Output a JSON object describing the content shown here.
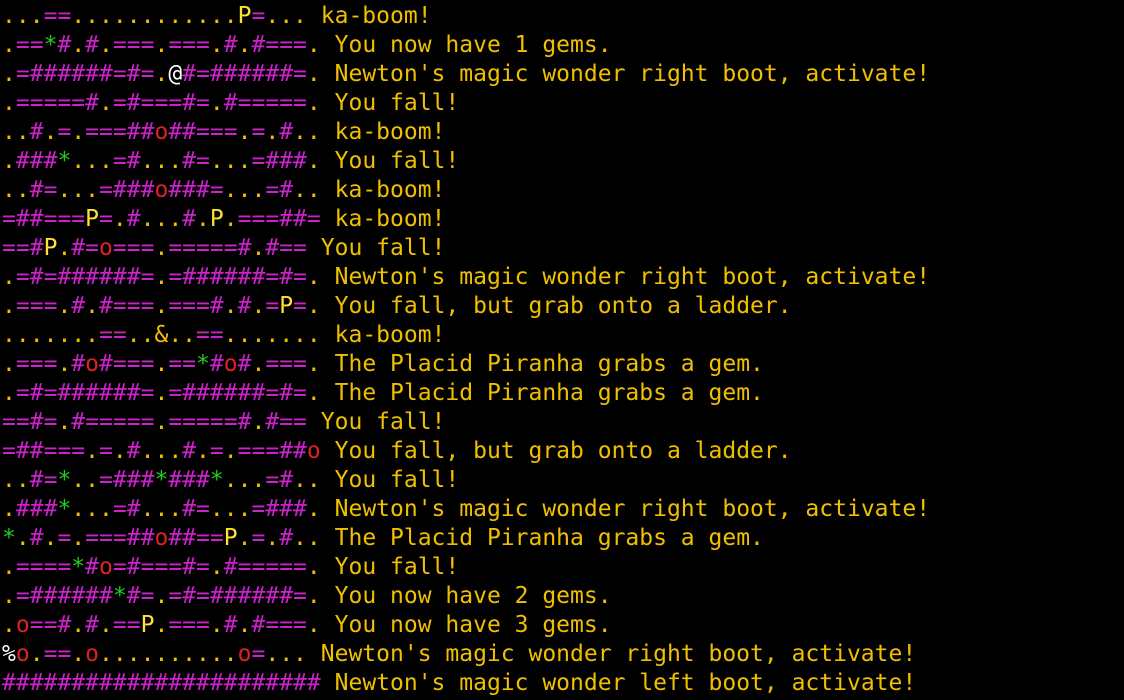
{
  "palette": {
    "background": "#000000",
    "text": "#f0c000",
    "wall": "#cc22cc",
    "gem": "#22cc22",
    "hole": "#dd2222",
    "player": "#ffe033",
    "hero": "#ffffff"
  },
  "terminal": {
    "lines": [
      {
        "map": "...==............P=...",
        "message": "ka-boom!"
      },
      {
        "map": ".==*#.#.===.===.#.#===.",
        "message": "You now have 1 gems."
      },
      {
        "map": ".=######=#=.@#=######=.",
        "message": "Newton's magic wonder right boot, activate!"
      },
      {
        "map": ".=====#.=#===#=.#=====.",
        "message": "You fall!"
      },
      {
        "map": "..#.=.===##o##===.=.#..",
        "message": "ka-boom!"
      },
      {
        "map": ".###*...=#...#=...=###.",
        "message": "You fall!"
      },
      {
        "map": "..#=...=###o###=...=#..",
        "message": "ka-boom!"
      },
      {
        "map": "=##===P=.#...#.P.===##=",
        "message": "ka-boom!"
      },
      {
        "map": "==#P.#=o===.=====#.#==",
        "message": "You fall!"
      },
      {
        "map": ".=#=######=.=######=#=.",
        "message": "Newton's magic wonder right boot, activate!"
      },
      {
        "map": ".===.#.#===.===#.#.=P=.",
        "message": "You fall, but grab onto a ladder."
      },
      {
        "map": ".......==..&..==.......",
        "message": "ka-boom!"
      },
      {
        "map": ".===.#o#===.==*#o#.===.",
        "message": "The Placid Piranha grabs a gem."
      },
      {
        "map": ".=#=######=.=######=#=.",
        "message": "The Placid Piranha grabs a gem."
      },
      {
        "map": "==#=.#=====.=====#.#==",
        "message": "You fall!"
      },
      {
        "map": "=##===.=.#...#.=.===##o",
        "message": "You fall, but grab onto a ladder."
      },
      {
        "map": "..#=*..=###*###*...=#..",
        "message": "You fall!"
      },
      {
        "map": ".###*...=#...#=...=###.",
        "message": "Newton's magic wonder right boot, activate!"
      },
      {
        "map": "*.#.=.===##o##==P.=.#..",
        "message": "The Placid Piranha grabs a gem."
      },
      {
        "map": ".====*#o=#===#=.#=====.",
        "message": "You fall!"
      },
      {
        "map": ".=######*#=.=#=######=.",
        "message": "You now have 2 gems."
      },
      {
        "map": ".o==#.#.==P.===.#.#===.",
        "message": "You now have 3 gems."
      },
      {
        "map": "%o.==.o..........o=...",
        "message": "Newton's magic wonder right boot, activate!"
      },
      {
        "map": "#######################",
        "message": "Newton's magic wonder left boot, activate!"
      }
    ]
  }
}
